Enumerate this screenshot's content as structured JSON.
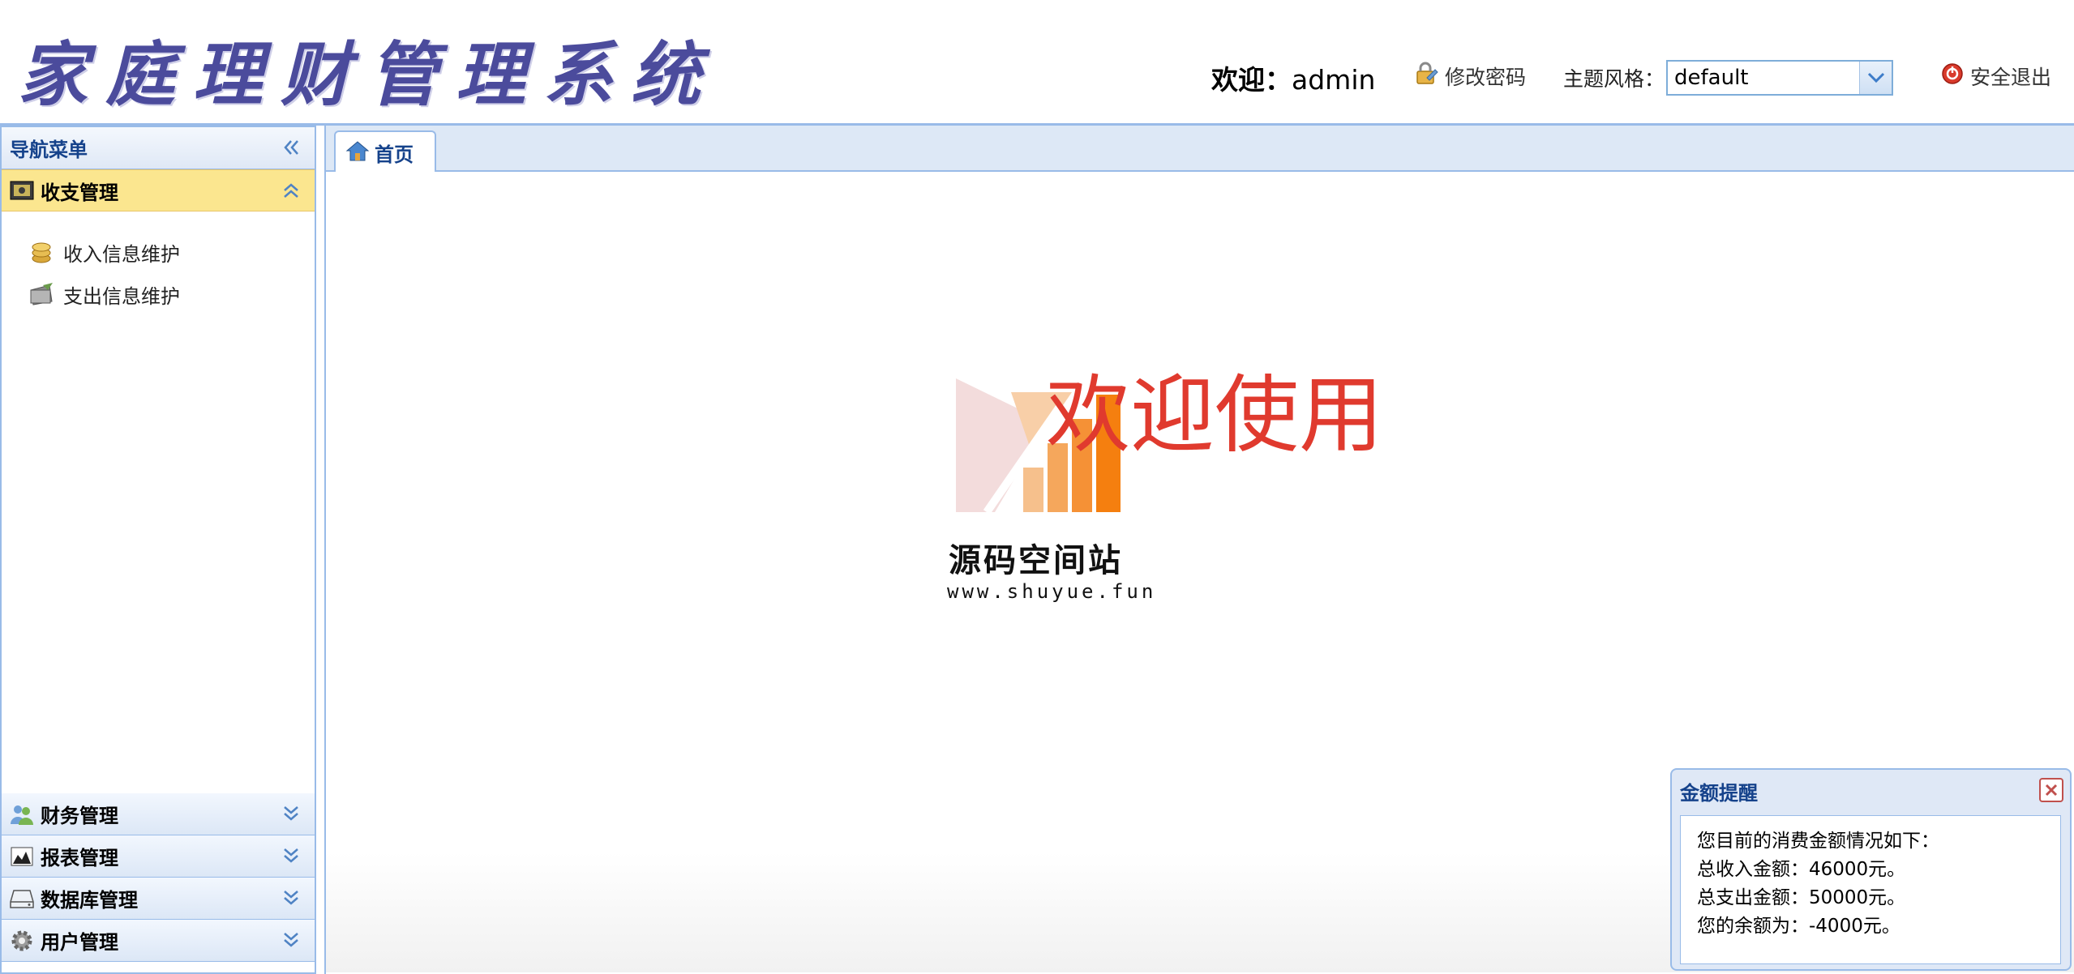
{
  "header": {
    "app_title": "家庭理财管理系统",
    "welcome_label": "欢迎：",
    "username": "admin",
    "change_password": "修改密码",
    "theme_label": "主题风格：",
    "theme_value": "default",
    "logout": "安全退出"
  },
  "sidebar": {
    "title": "导航菜单",
    "sections": [
      {
        "label": "收支管理",
        "icon": "money-icon",
        "expanded": true
      },
      {
        "label": "财务管理",
        "icon": "users-icon",
        "expanded": false
      },
      {
        "label": "报表管理",
        "icon": "chart-icon",
        "expanded": false
      },
      {
        "label": "数据库管理",
        "icon": "drive-icon",
        "expanded": false
      },
      {
        "label": "用户管理",
        "icon": "gear-icon",
        "expanded": false
      }
    ],
    "items": [
      {
        "label": "收入信息维护",
        "icon": "coins-icon"
      },
      {
        "label": "支出信息维护",
        "icon": "wallet-icon"
      }
    ]
  },
  "tabs": [
    {
      "label": "首页",
      "icon": "home-icon"
    }
  ],
  "content": {
    "welcome": "欢迎使用",
    "brand_name": "源码空间站",
    "brand_url": "www.shuyue.fun"
  },
  "notice": {
    "title": "金额提醒",
    "lines": [
      "您目前的消费金额情况如下：",
      "总收入金额：46000元。",
      "总支出金额：50000元。",
      "您的余额为：-4000元。"
    ]
  },
  "colors": {
    "border": "#99bbe8",
    "title_text": "#15428b",
    "active_section": "#fbe68f",
    "welcome_red": "#e03a2e"
  }
}
